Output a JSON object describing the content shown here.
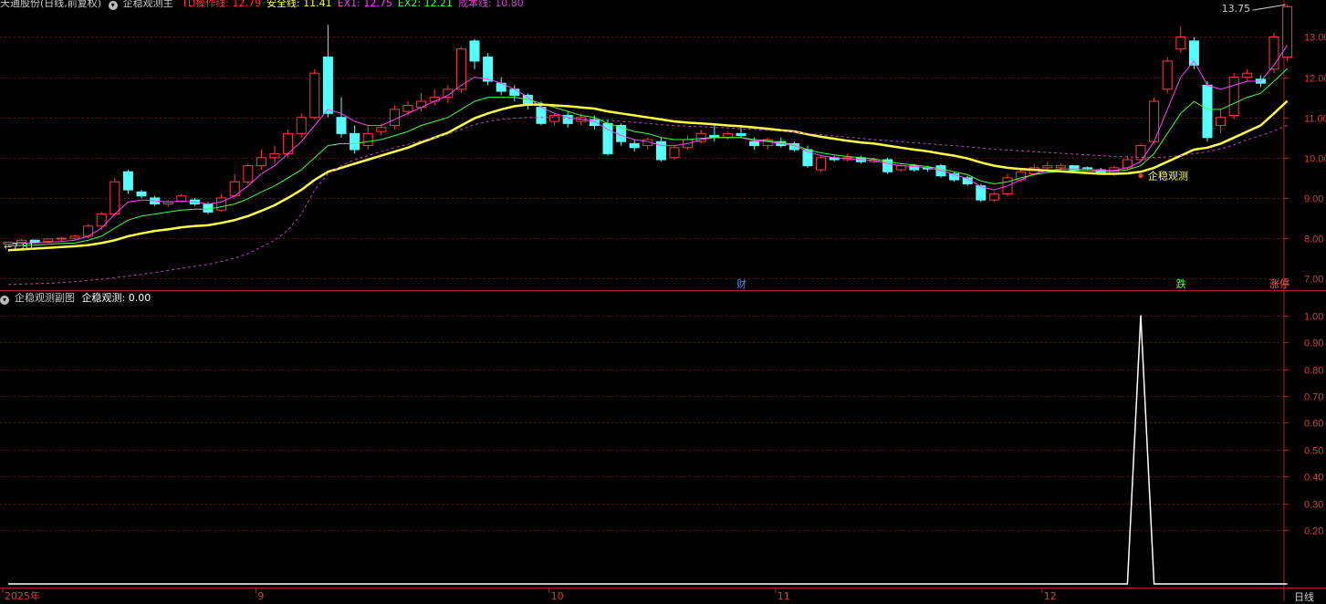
{
  "main_header": {
    "stock_title": "天通股份(日线,前复权)",
    "indicator_name": "企稳观测主",
    "items": [
      {
        "label": "TD操作线",
        "value": "12.79",
        "color": "#ff3030"
      },
      {
        "label": "安全线",
        "value": "11.41",
        "color": "#ffff40"
      },
      {
        "label": "EX1",
        "value": "12.75",
        "color": "#ff40ff"
      },
      {
        "label": "EX2",
        "value": "12.21",
        "color": "#40ff40"
      },
      {
        "label": "成本线",
        "value": "10.80",
        "color": "#d040d0"
      }
    ]
  },
  "sub_header": {
    "indicator_name": "企稳观测副图",
    "items": [
      {
        "label": "企稳观测",
        "value": "0.00",
        "color": "#ffffff"
      }
    ]
  },
  "annotations": {
    "max_price": "13.75",
    "min_price": "7.81",
    "signal_label": "企稳观测",
    "event_markers": [
      {
        "text": "财",
        "index": 55,
        "color": "#4090ff"
      },
      {
        "text": "跌",
        "index": 88,
        "color": "#40ff40"
      },
      {
        "text": "涨停",
        "index": 95,
        "color": "#ff6060"
      }
    ]
  },
  "x_axis": {
    "labels": [
      {
        "text": "2025年",
        "index": 0
      },
      {
        "text": "9",
        "index": 19
      },
      {
        "text": "10",
        "index": 41
      },
      {
        "text": "11",
        "index": 58
      },
      {
        "text": "12",
        "index": 78
      }
    ],
    "period": "日线"
  },
  "chart_data": [
    {
      "type": "candlestick",
      "title": "企稳观测主",
      "ylim": [
        6.8,
        13.6
      ],
      "y_ticks": [
        "13.00",
        "12.00",
        "11.00",
        "10.00",
        "9.00",
        "8.00",
        "7.00"
      ],
      "tick_values": [
        13,
        12,
        11,
        10,
        9,
        8,
        7
      ],
      "candles": [
        [
          7.85,
          7.9,
          7.8,
          7.92
        ],
        [
          7.9,
          7.95,
          7.85,
          7.98
        ],
        [
          7.95,
          7.9,
          7.86,
          7.97
        ],
        [
          7.92,
          7.98,
          7.88,
          8.0
        ],
        [
          7.98,
          8.0,
          7.93,
          8.03
        ],
        [
          8.0,
          8.05,
          7.96,
          8.08
        ],
        [
          8.05,
          8.3,
          8.0,
          8.35
        ],
        [
          8.3,
          8.6,
          8.2,
          8.65
        ],
        [
          8.6,
          9.4,
          8.55,
          9.5
        ],
        [
          9.65,
          9.2,
          9.1,
          9.7
        ],
        [
          9.15,
          9.05,
          9.0,
          9.2
        ],
        [
          9.0,
          8.85,
          8.8,
          9.05
        ],
        [
          8.85,
          8.9,
          8.78,
          8.95
        ],
        [
          8.92,
          9.05,
          8.88,
          9.1
        ],
        [
          8.95,
          8.85,
          8.8,
          9.0
        ],
        [
          8.85,
          8.65,
          8.6,
          8.9
        ],
        [
          8.7,
          9.0,
          8.65,
          9.1
        ],
        [
          9.05,
          9.4,
          9.0,
          9.6
        ],
        [
          9.4,
          9.8,
          9.35,
          9.85
        ],
        [
          9.8,
          10.0,
          9.7,
          10.2
        ],
        [
          10.0,
          10.1,
          9.85,
          10.3
        ],
        [
          10.1,
          10.6,
          10.0,
          10.7
        ],
        [
          10.6,
          11.0,
          10.5,
          11.1
        ],
        [
          11.0,
          12.1,
          10.95,
          12.2
        ],
        [
          12.5,
          11.1,
          11.0,
          13.3
        ],
        [
          11.0,
          10.6,
          10.5,
          11.5
        ],
        [
          10.6,
          10.2,
          10.1,
          10.8
        ],
        [
          10.3,
          10.6,
          10.2,
          10.8
        ],
        [
          10.65,
          10.75,
          10.55,
          10.85
        ],
        [
          10.8,
          11.2,
          10.7,
          11.3
        ],
        [
          11.15,
          11.3,
          11.05,
          11.4
        ],
        [
          11.25,
          11.4,
          11.15,
          11.6
        ],
        [
          11.4,
          11.5,
          11.3,
          11.7
        ],
        [
          11.5,
          11.7,
          11.35,
          11.8
        ],
        [
          11.7,
          12.7,
          11.6,
          12.75
        ],
        [
          12.9,
          12.4,
          12.2,
          12.95
        ],
        [
          12.5,
          11.9,
          11.8,
          12.6
        ],
        [
          11.85,
          11.65,
          11.55,
          12.0
        ],
        [
          11.7,
          11.55,
          11.4,
          11.8
        ],
        [
          11.55,
          11.3,
          11.2,
          11.6
        ],
        [
          11.25,
          10.85,
          10.8,
          11.4
        ],
        [
          10.9,
          11.05,
          10.8,
          11.1
        ],
        [
          11.05,
          10.85,
          10.75,
          11.15
        ],
        [
          10.9,
          11.0,
          10.8,
          11.1
        ],
        [
          10.95,
          10.8,
          10.7,
          11.05
        ],
        [
          10.85,
          10.1,
          10.05,
          10.95
        ],
        [
          10.8,
          10.4,
          10.3,
          10.85
        ],
        [
          10.35,
          10.25,
          10.15,
          10.45
        ],
        [
          10.3,
          10.45,
          10.2,
          10.5
        ],
        [
          10.4,
          9.95,
          9.9,
          10.5
        ],
        [
          10.0,
          10.25,
          9.95,
          10.3
        ],
        [
          10.25,
          10.45,
          10.2,
          10.55
        ],
        [
          10.4,
          10.6,
          10.35,
          10.7
        ],
        [
          10.55,
          10.5,
          10.4,
          10.8
        ],
        [
          10.5,
          10.6,
          10.45,
          10.65
        ],
        [
          10.6,
          10.55,
          10.5,
          10.75
        ],
        [
          10.4,
          10.3,
          10.2,
          10.5
        ],
        [
          10.3,
          10.45,
          10.2,
          10.5
        ],
        [
          10.4,
          10.3,
          10.25,
          10.5
        ],
        [
          10.35,
          10.2,
          10.15,
          10.4
        ],
        [
          10.2,
          9.8,
          9.75,
          10.3
        ],
        [
          9.7,
          10.0,
          9.65,
          10.05
        ],
        [
          10.0,
          9.95,
          9.9,
          10.05
        ],
        [
          9.95,
          10.0,
          9.9,
          10.1
        ],
        [
          10.0,
          9.9,
          9.85,
          10.05
        ],
        [
          9.9,
          9.95,
          9.85,
          10.0
        ],
        [
          9.95,
          9.65,
          9.6,
          10.0
        ],
        [
          9.7,
          9.8,
          9.65,
          9.85
        ],
        [
          9.8,
          9.7,
          9.65,
          9.85
        ],
        [
          9.75,
          9.72,
          9.65,
          9.8
        ],
        [
          9.8,
          9.55,
          9.5,
          9.85
        ],
        [
          9.6,
          9.45,
          9.4,
          9.65
        ],
        [
          9.5,
          9.35,
          9.3,
          9.55
        ],
        [
          9.3,
          8.95,
          8.9,
          9.35
        ],
        [
          8.95,
          9.1,
          8.9,
          9.15
        ],
        [
          9.1,
          9.5,
          9.05,
          9.6
        ],
        [
          9.45,
          9.65,
          9.4,
          9.75
        ],
        [
          9.6,
          9.75,
          9.55,
          9.85
        ],
        [
          9.75,
          9.8,
          9.65,
          9.9
        ],
        [
          9.75,
          9.8,
          9.7,
          9.85
        ],
        [
          9.8,
          9.7,
          9.68,
          9.8
        ],
        [
          9.75,
          9.72,
          9.68,
          9.78
        ],
        [
          9.7,
          9.62,
          9.6,
          9.75
        ],
        [
          9.6,
          9.75,
          9.55,
          9.8
        ],
        [
          9.75,
          9.95,
          9.7,
          10.05
        ],
        [
          9.95,
          10.3,
          9.9,
          10.35
        ],
        [
          10.4,
          11.4,
          10.35,
          11.5
        ],
        [
          11.7,
          12.4,
          11.6,
          12.5
        ],
        [
          12.7,
          13.0,
          12.6,
          13.25
        ],
        [
          12.9,
          12.3,
          12.2,
          13.0
        ],
        [
          11.8,
          10.5,
          10.4,
          11.9
        ],
        [
          10.8,
          11.0,
          10.6,
          11.2
        ],
        [
          11.05,
          12.0,
          10.95,
          12.1
        ],
        [
          12.0,
          12.1,
          11.9,
          12.2
        ],
        [
          11.95,
          11.85,
          11.75,
          12.05
        ],
        [
          12.2,
          13.0,
          12.1,
          13.1
        ],
        [
          12.5,
          13.75,
          12.4,
          13.8
        ]
      ],
      "series": [
        {
          "name": "TD操作线",
          "color": "#ff40ff",
          "values": [
            7.85,
            7.87,
            7.88,
            7.9,
            7.92,
            7.95,
            8.05,
            8.25,
            8.6,
            8.9,
            8.95,
            8.93,
            8.9,
            8.92,
            8.9,
            8.85,
            8.9,
            9.05,
            9.3,
            9.6,
            9.8,
            10.1,
            10.4,
            10.8,
            11.2,
            11.1,
            10.9,
            10.8,
            10.8,
            10.95,
            11.1,
            11.25,
            11.4,
            11.55,
            11.8,
            12.0,
            11.95,
            11.85,
            11.7,
            11.5,
            11.25,
            11.1,
            11.0,
            10.95,
            10.9,
            10.7,
            10.55,
            10.45,
            10.4,
            10.3,
            10.3,
            10.35,
            10.45,
            10.5,
            10.5,
            10.5,
            10.42,
            10.4,
            10.35,
            10.3,
            10.15,
            10.05,
            10.0,
            9.98,
            9.95,
            9.93,
            9.85,
            9.8,
            9.78,
            9.75,
            9.68,
            9.58,
            9.48,
            9.28,
            9.2,
            9.3,
            9.45,
            9.6,
            9.68,
            9.72,
            9.72,
            9.72,
            9.68,
            9.68,
            9.75,
            9.9,
            10.4,
            11.2,
            12.0,
            12.4,
            11.8,
            11.7,
            11.8,
            11.9,
            11.9,
            12.3,
            12.79
          ]
        },
        {
          "name": "EX2",
          "color": "#40ff40",
          "values": [
            7.8,
            7.82,
            7.83,
            7.85,
            7.87,
            7.88,
            7.95,
            8.05,
            8.25,
            8.45,
            8.55,
            8.6,
            8.65,
            8.7,
            8.72,
            8.72,
            8.78,
            8.85,
            8.98,
            9.15,
            9.3,
            9.5,
            9.7,
            10.0,
            10.3,
            10.35,
            10.35,
            10.4,
            10.45,
            10.55,
            10.65,
            10.8,
            10.9,
            11.0,
            11.2,
            11.4,
            11.5,
            11.5,
            11.5,
            11.45,
            11.35,
            11.25,
            11.15,
            11.05,
            11.0,
            10.85,
            10.75,
            10.65,
            10.6,
            10.5,
            10.45,
            10.45,
            10.48,
            10.5,
            10.5,
            10.5,
            10.45,
            10.42,
            10.38,
            10.32,
            10.2,
            10.12,
            10.07,
            10.03,
            10.0,
            9.97,
            9.9,
            9.85,
            9.82,
            9.78,
            9.72,
            9.65,
            9.58,
            9.42,
            9.35,
            9.4,
            9.5,
            9.58,
            9.63,
            9.66,
            9.68,
            9.68,
            9.66,
            9.66,
            9.7,
            9.8,
            10.1,
            10.6,
            11.1,
            11.4,
            11.2,
            11.2,
            11.35,
            11.5,
            11.6,
            11.9,
            12.21
          ]
        },
        {
          "name": "安全线",
          "color": "#ffff40",
          "width": 2.5,
          "values": [
            7.7,
            7.72,
            7.74,
            7.76,
            7.78,
            7.8,
            7.83,
            7.88,
            7.95,
            8.05,
            8.12,
            8.18,
            8.22,
            8.27,
            8.3,
            8.32,
            8.38,
            8.45,
            8.55,
            8.68,
            8.82,
            9.0,
            9.2,
            9.45,
            9.65,
            9.75,
            9.85,
            9.95,
            10.05,
            10.15,
            10.25,
            10.38,
            10.5,
            10.62,
            10.8,
            10.98,
            11.1,
            11.2,
            11.28,
            11.32,
            11.32,
            11.3,
            11.28,
            11.25,
            11.22,
            11.15,
            11.1,
            11.05,
            11.0,
            10.95,
            10.9,
            10.87,
            10.85,
            10.83,
            10.8,
            10.78,
            10.75,
            10.72,
            10.68,
            10.65,
            10.58,
            10.52,
            10.47,
            10.42,
            10.38,
            10.35,
            10.3,
            10.25,
            10.2,
            10.16,
            10.1,
            10.05,
            9.98,
            9.88,
            9.8,
            9.75,
            9.72,
            9.7,
            9.68,
            9.66,
            9.64,
            9.62,
            9.6,
            9.6,
            9.61,
            9.65,
            9.75,
            9.9,
            10.05,
            10.2,
            10.25,
            10.35,
            10.5,
            10.65,
            10.8,
            11.1,
            11.41
          ]
        },
        {
          "name": "成本线",
          "color": "#c040c0",
          "dashed": true,
          "values": [
            6.85,
            6.86,
            6.87,
            6.88,
            6.9,
            6.92,
            6.95,
            6.98,
            7.02,
            7.06,
            7.1,
            7.15,
            7.2,
            7.25,
            7.3,
            7.35,
            7.42,
            7.5,
            7.62,
            7.78,
            7.95,
            8.2,
            8.6,
            9.2,
            9.6,
            9.8,
            9.95,
            10.05,
            10.15,
            10.25,
            10.33,
            10.42,
            10.5,
            10.58,
            10.7,
            10.82,
            10.9,
            10.95,
            10.98,
            11.0,
            11.0,
            11.0,
            10.98,
            10.96,
            10.95,
            10.93,
            10.9,
            10.88,
            10.85,
            10.82,
            10.8,
            10.78,
            10.77,
            10.75,
            10.74,
            10.72,
            10.7,
            10.68,
            10.66,
            10.64,
            10.6,
            10.57,
            10.54,
            10.51,
            10.48,
            10.45,
            10.42,
            10.4,
            10.37,
            10.35,
            10.32,
            10.3,
            10.27,
            10.24,
            10.21,
            10.19,
            10.17,
            10.15,
            10.13,
            10.11,
            10.09,
            10.07,
            10.05,
            10.03,
            10.02,
            10.01,
            10.0,
            10.02,
            10.05,
            10.1,
            10.15,
            10.22,
            10.32,
            10.45,
            10.55,
            10.67,
            10.8
          ]
        }
      ]
    },
    {
      "type": "line",
      "title": "企稳观测副图",
      "ylim": [
        0,
        1.05
      ],
      "y_ticks": [
        "1.00",
        "0.90",
        "0.80",
        "0.70",
        "0.60",
        "0.50",
        "0.40",
        "0.30",
        "0.20"
      ],
      "tick_values": [
        1.0,
        0.9,
        0.8,
        0.7,
        0.6,
        0.5,
        0.4,
        0.3,
        0.2
      ],
      "series": [
        {
          "name": "企稳观测",
          "color": "#ffffff",
          "values": [
            0,
            0,
            0,
            0,
            0,
            0,
            0,
            0,
            0,
            0,
            0,
            0,
            0,
            0,
            0,
            0,
            0,
            0,
            0,
            0,
            0,
            0,
            0,
            0,
            0,
            0,
            0,
            0,
            0,
            0,
            0,
            0,
            0,
            0,
            0,
            0,
            0,
            0,
            0,
            0,
            0,
            0,
            0,
            0,
            0,
            0,
            0,
            0,
            0,
            0,
            0,
            0,
            0,
            0,
            0,
            0,
            0,
            0,
            0,
            0,
            0,
            0,
            0,
            0,
            0,
            0,
            0,
            0,
            0,
            0,
            0,
            0,
            0,
            0,
            0,
            0,
            0,
            0,
            0,
            0,
            0,
            0,
            0,
            0,
            0,
            1,
            0,
            0,
            0,
            0,
            0,
            0,
            0,
            0,
            0,
            0,
            0
          ]
        }
      ]
    }
  ]
}
